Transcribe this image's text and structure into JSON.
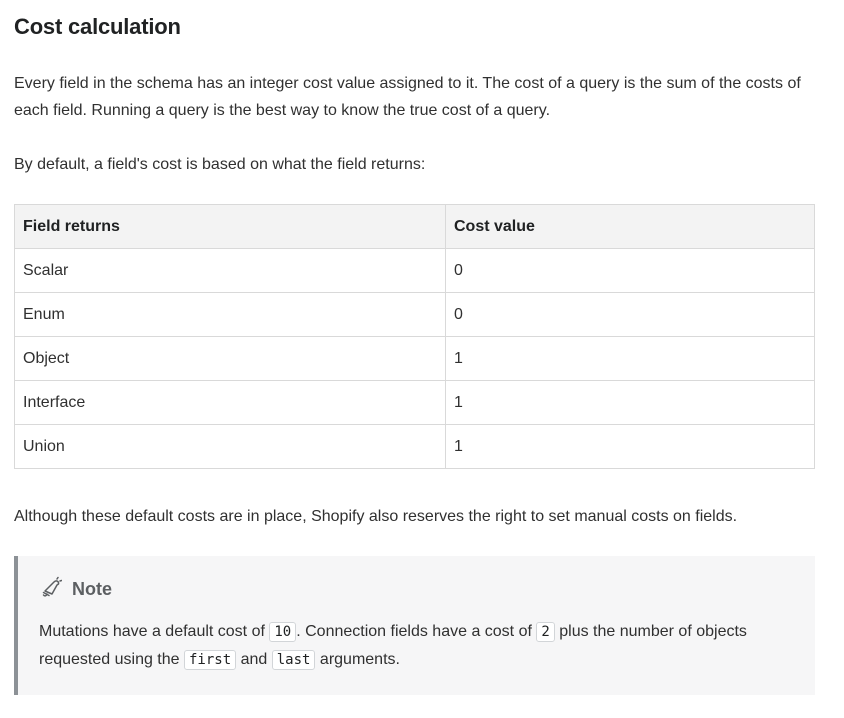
{
  "heading": "Cost calculation",
  "intro": "Every field in the schema has an integer cost value assigned to it. The cost of a query is the sum of the costs of each field. Running a query is the best way to know the true cost of a query.",
  "default_text": "By default, a field's cost is based on what the field returns:",
  "table": {
    "headers": [
      "Field returns",
      "Cost value"
    ],
    "rows": [
      [
        "Scalar",
        "0"
      ],
      [
        "Enum",
        "0"
      ],
      [
        "Object",
        "1"
      ],
      [
        "Interface",
        "1"
      ],
      [
        "Union",
        "1"
      ]
    ]
  },
  "manual_text": "Although these default costs are in place, Shopify also reserves the right to set manual costs on fields.",
  "note": {
    "icon": "bell-icon",
    "title": "Note",
    "part1": "Mutations have a default cost of ",
    "code1": "10",
    "part2": ". Connection fields have a cost of ",
    "code2": "2",
    "part3": " plus the number of objects requested using the ",
    "code3": "first",
    "part4": " and ",
    "code4": "last",
    "part5": " arguments."
  }
}
